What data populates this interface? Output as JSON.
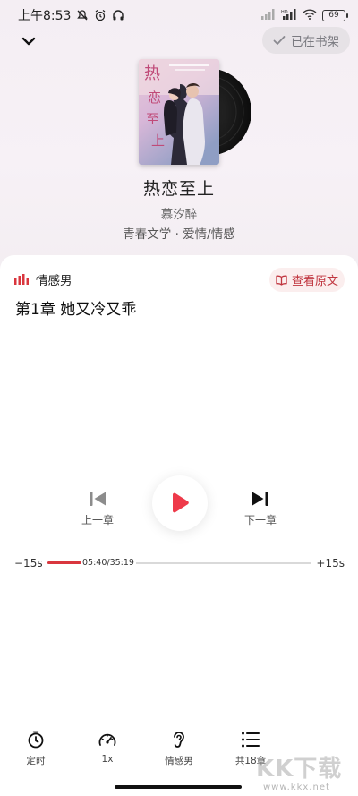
{
  "status_bar": {
    "time": "上午8:53",
    "battery": "69",
    "network": "HD"
  },
  "header": {
    "shelf_label": "已在书架"
  },
  "book": {
    "title": "热恋至上",
    "author": "慕汐醉",
    "tags": "青春文学 · 爱情/情感"
  },
  "player": {
    "narrator": "情感男",
    "view_original_label": "查看原文",
    "chapter_title": "第1章 她又冷又乖",
    "prev_label": "上一章",
    "next_label": "下一章",
    "skip_back": "−15s",
    "skip_forward": "+15s",
    "time_display": "05:40/35:19",
    "progress_fraction": 0.16
  },
  "bottom_nav": [
    {
      "label": "定时",
      "icon": "timer-icon"
    },
    {
      "label": "1x",
      "icon": "speed-icon"
    },
    {
      "label": "情感男",
      "icon": "ear-icon"
    },
    {
      "label": "共18章",
      "icon": "list-icon"
    }
  ],
  "watermark": {
    "text": "KK下载",
    "url": "www.kkx.net"
  },
  "colors": {
    "accent": "#d9363e",
    "play": "#ee3a4a"
  }
}
